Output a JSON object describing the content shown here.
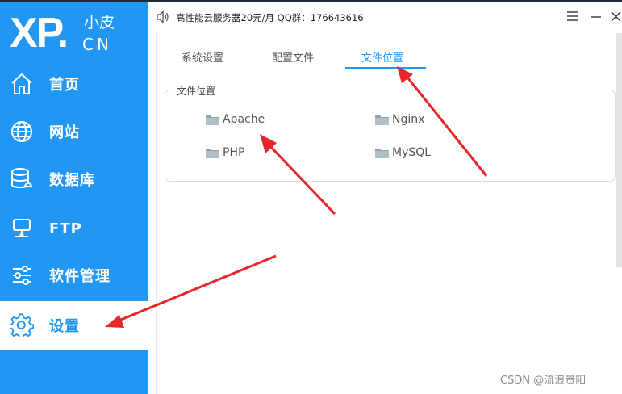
{
  "app": {
    "logo_main": "XP.",
    "logo_cn_top": "小皮",
    "logo_cn_bottom": "CN",
    "announcement": "高性能云服务器20元/月  QQ群：176643616"
  },
  "sidebar": {
    "items": [
      {
        "label": "首页",
        "icon": "home-icon"
      },
      {
        "label": "网站",
        "icon": "globe-icon"
      },
      {
        "label": "数据库",
        "icon": "database-icon"
      },
      {
        "label": "FTP",
        "icon": "server-icon"
      },
      {
        "label": "软件管理",
        "icon": "sliders-icon"
      },
      {
        "label": "设置",
        "icon": "gear-icon",
        "active": true
      }
    ]
  },
  "tabs": [
    {
      "label": "系统设置"
    },
    {
      "label": "配置文件"
    },
    {
      "label": "文件位置",
      "active": true
    }
  ],
  "file_location": {
    "legend": "文件位置",
    "links": [
      {
        "label": "Apache",
        "icon": "folder-icon"
      },
      {
        "label": "Nginx",
        "icon": "folder-icon"
      },
      {
        "label": "PHP",
        "icon": "folder-icon"
      },
      {
        "label": "MySQL",
        "icon": "folder-icon"
      }
    ]
  },
  "watermark": "CSDN @流浪贵阳",
  "colors": {
    "accent": "#2196f3",
    "annotation_arrow": "#e8262a"
  }
}
